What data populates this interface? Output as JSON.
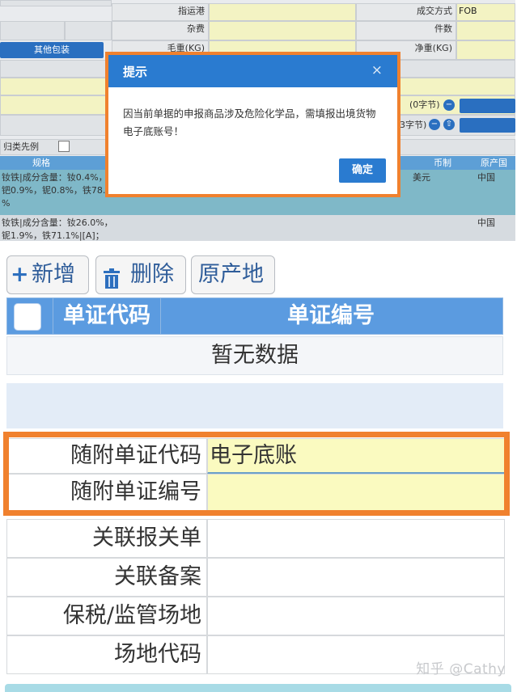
{
  "top_form": {
    "port_label": "指运港",
    "deal_mode_label": "成交方式",
    "deal_mode_value": "FOB",
    "misc_fee_label": "杂费",
    "pieces_label": "件数",
    "other_pack_button": "其他包装",
    "gross_weight_label": "毛重(KG)",
    "net_weight_label": "净重(KG)",
    "bytes_label_1": "(0字节)",
    "bytes_label_2": "3字节)",
    "classify_label": "归类先例",
    "columns": {
      "spec": "规格",
      "currency": "币制",
      "origin": "原产国"
    },
    "rows": [
      {
        "spec_text": "钕铁|成分含量：钕0.4%，\n钯0.9%，铌0.8%，铁78.0\n%",
        "currency": "美元",
        "origin": "中国"
      },
      {
        "spec_text": "钕铁|成分含量：钕26.0%，\n铌1.9%，铁71.1%|[A]；",
        "currency": "",
        "origin": "中国"
      }
    ]
  },
  "dialog": {
    "title": "提示",
    "close_symbol": "×",
    "message": "因当前单据的申报商品涉及危险化学品，需填报出境货物电子底账号！",
    "ok_button": "确定",
    "highlight_color": "#f0812e"
  },
  "bottom_panel": {
    "toolbar": {
      "add_icon": "+",
      "add_label": "新增",
      "delete_label": "删除",
      "origin_label": "原产地"
    },
    "grid": {
      "col_code": "单证代码",
      "col_number": "单证编号",
      "empty_text": "暂无数据"
    },
    "fields": {
      "attached_doc_code_label": "随附单证代码",
      "attached_doc_code_value": "电子底账",
      "attached_doc_number_label": "随附单证编号",
      "attached_doc_number_value": "",
      "related_declaration_label": "关联报关单",
      "related_record_label": "关联备案",
      "bonded_site_label": "保税/监管场地",
      "site_code_label": "场地代码"
    },
    "watermark": "知乎 @Cathy"
  },
  "colors": {
    "accent_blue": "#2a7bd0",
    "grid_header_blue": "#5b9be0",
    "highlight_orange": "#f0812e",
    "field_yellow": "#fafac0"
  }
}
